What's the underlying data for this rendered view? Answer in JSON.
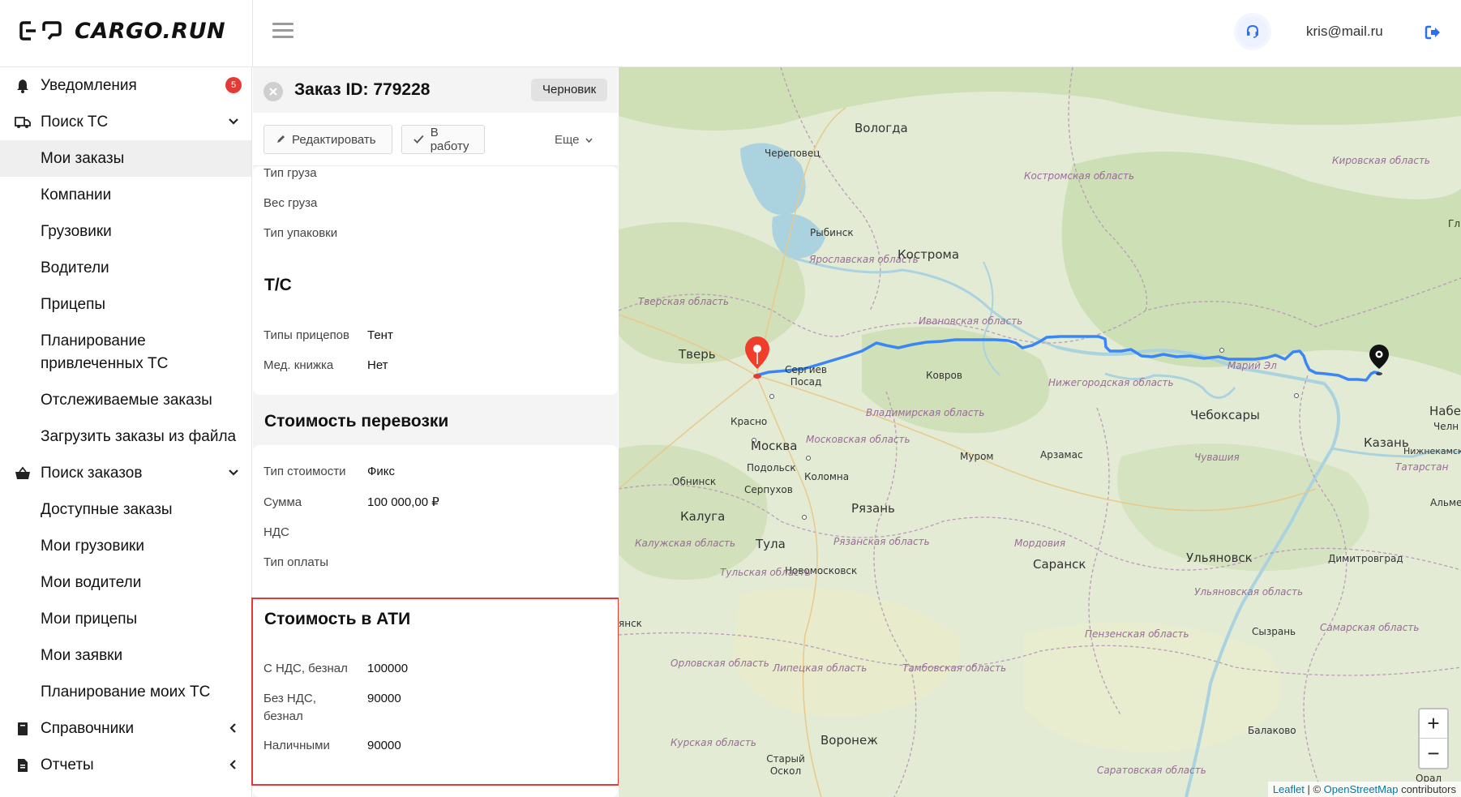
{
  "app": {
    "brand": "CARGO.RUN"
  },
  "header": {
    "user_email": "kris@mail.ru"
  },
  "sidebar": {
    "items": [
      {
        "label": "Уведомления",
        "badge": "5"
      },
      {
        "label": "Поиск ТС"
      },
      {
        "label": "Мои заказы"
      },
      {
        "label": "Компании"
      },
      {
        "label": "Грузовики"
      },
      {
        "label": "Водители"
      },
      {
        "label": "Прицепы"
      },
      {
        "label": "Планирование привлеченных ТС"
      },
      {
        "label": "Отслеживаемые заказы"
      },
      {
        "label": "Загрузить заказы из файла"
      },
      {
        "label": "Поиск заказов"
      },
      {
        "label": "Доступные заказы"
      },
      {
        "label": "Мои грузовики"
      },
      {
        "label": "Мои водители"
      },
      {
        "label": "Мои прицепы"
      },
      {
        "label": "Мои заявки"
      },
      {
        "label": "Планирование моих ТС"
      },
      {
        "label": "Справочники"
      },
      {
        "label": "Отчеты"
      }
    ]
  },
  "order": {
    "title": "Заказ ID: 779228",
    "status": "Черновик",
    "actions": {
      "edit": "Редактировать",
      "to_work": "В работу",
      "more": "Еще"
    },
    "cargo": {
      "rows": [
        {
          "key": "Тип груза",
          "value": ""
        },
        {
          "key": "Вес груза",
          "value": ""
        },
        {
          "key": "Тип упаковки",
          "value": ""
        }
      ]
    },
    "vehicle": {
      "title": "Т/С",
      "rows": [
        {
          "key": "Типы прицепов",
          "value": "Тент"
        },
        {
          "key": "Мед. книжка",
          "value": "Нет"
        }
      ]
    },
    "cost": {
      "title": "Стоимость перевозки",
      "rows": [
        {
          "key": "Тип стоимости",
          "value": "Фикс"
        },
        {
          "key": "Сумма",
          "value": "100 000,00 ₽"
        },
        {
          "key": "НДС",
          "value": ""
        },
        {
          "key": "Тип оплаты",
          "value": ""
        }
      ]
    },
    "ati": {
      "title": "Стоимость в АТИ",
      "rows": [
        {
          "key": "С НДС, безнал",
          "value": "100000"
        },
        {
          "key": "Без НДС, безнал",
          "value": "90000"
        },
        {
          "key": "Наличными",
          "value": "90000"
        }
      ]
    }
  },
  "map": {
    "labels": {
      "vologda": "Вологда",
      "cherepovets": "Череповец",
      "kostroma_obl": "Костромская область",
      "kirov_obl": "Кировская область",
      "rybinsk": "Рыбинск",
      "yaroslavl_obl": "Ярославская область",
      "kostroma": "Кострома",
      "tver_obl": "Тверская область",
      "ivanovo_obl": "Ивановская область",
      "tver": "Тверь",
      "sergiev_posad": "Сергиев Посад",
      "kovrov": "Ковров",
      "nizhegorod_obl": "Нижегородская область",
      "mariy_el": "Марий Эл",
      "krasnogorsk": "Красно",
      "vladimir_obl": "Владимирская область",
      "cheboksary": "Чебоксары",
      "naberezh": "Набере",
      "chel": "Челн",
      "moskva": "Москва",
      "moscow_obl": "Московская область",
      "kazan": "Казань",
      "murom": "Муром",
      "arzamas": "Арзамас",
      "chuvashia": "Чувашия",
      "nizhnekamsk": "Нижнекамск",
      "podolsk": "Подольск",
      "tatarstan": "Татарстан",
      "obninsk": "Обнинск",
      "kolomna": "Коломна",
      "serpukhov": "Серпухов",
      "ryazan": "Рязань",
      "almetyevsk": "Альметь",
      "kaluga": "Калуга",
      "kaluga_obl": "Калужская область",
      "ryazan_obl": "Рязанская область",
      "mordovia": "Мордовия",
      "tula": "Тула",
      "saransk": "Саранск",
      "ulyanovsk": "Ульяновск",
      "dimitrovgrad": "Димитровград",
      "novomoskovsk": "Новомосковск",
      "tula_obl": "Тульская область",
      "ulyanovsk_obl": "Ульяновская область",
      "yansk": "янск",
      "samara_obl": "Самарская область",
      "penza_obl": "Пензенская область",
      "syzran": "Сызрань",
      "orel_obl": "Орловская область",
      "lipetsk_obl": "Липецкая область",
      "tambov_obl": "Тамбовская область",
      "balakovo": "Балаково",
      "voronezh": "Воронеж",
      "kursk_obl": "Курская область",
      "stary_oskol": "Старый Оскол",
      "saratov_obl": "Саратовская область",
      "oral": "Орал",
      "gl": "Гл"
    },
    "zoom_in": "+",
    "zoom_out": "−",
    "attribution": {
      "leaflet": "Leaflet",
      "sep": " | © ",
      "osm": "OpenStreetMap",
      "contrib": " contributors"
    }
  },
  "colors": {
    "accent": "#2f6fed",
    "danger": "#e53935",
    "route": "#3b86f5"
  }
}
